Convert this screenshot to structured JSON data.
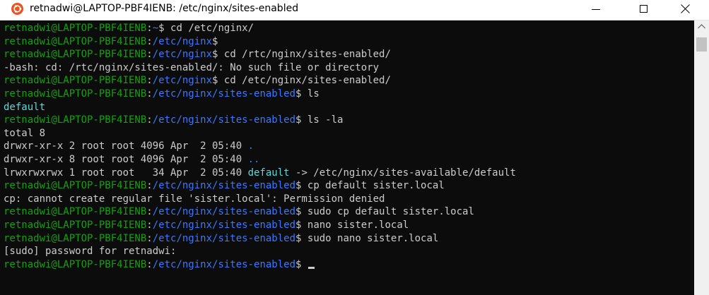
{
  "window": {
    "title": "retnadwi@LAPTOP-PBF4IENB: /etc/nginx/sites-enabled",
    "app_icon": "ubuntu-icon",
    "controls": [
      "minimize-icon",
      "maximize-icon",
      "close-icon"
    ]
  },
  "colors": {
    "terminal_bg": "#0c0c0c",
    "text": "#cccccc",
    "user_host": "#13a10e",
    "path": "#3b78ff",
    "symlink": "#61d6d6",
    "app_icon": "#e95420"
  },
  "terminal": {
    "lines": [
      {
        "type": "prompt",
        "user": "retnadwi@LAPTOP-PBF4IENB",
        "sep": ":",
        "path": "~",
        "sym": "$",
        "cmd": " cd /etc/nginx/"
      },
      {
        "type": "prompt",
        "user": "retnadwi@LAPTOP-PBF4IENB",
        "sep": ":",
        "path": "/etc/nginx",
        "sym": "$",
        "cmd": ""
      },
      {
        "type": "prompt",
        "user": "retnadwi@LAPTOP-PBF4IENB",
        "sep": ":",
        "path": "/etc/nginx",
        "sym": "$",
        "cmd": " cd /rtc/nginx/sites-enabled/"
      },
      {
        "type": "output",
        "text": "-bash: cd: /rtc/nginx/sites-enabled/: No such file or directory"
      },
      {
        "type": "prompt",
        "user": "retnadwi@LAPTOP-PBF4IENB",
        "sep": ":",
        "path": "/etc/nginx",
        "sym": "$",
        "cmd": " cd /etc/nginx/sites-enabled/"
      },
      {
        "type": "prompt",
        "user": "retnadwi@LAPTOP-PBF4IENB",
        "sep": ":",
        "path": "/etc/nginx/sites-enabled",
        "sym": "$",
        "cmd": " ls"
      },
      {
        "type": "ls",
        "name": "default"
      },
      {
        "type": "prompt",
        "user": "retnadwi@LAPTOP-PBF4IENB",
        "sep": ":",
        "path": "/etc/nginx/sites-enabled",
        "sym": "$",
        "cmd": " ls -la"
      },
      {
        "type": "output",
        "text": "total 8"
      },
      {
        "type": "entry",
        "pre": "drwxr-xr-x 2 root root 4096 Apr  2 05:40 ",
        "name": ".",
        "post": "",
        "kind": "dir"
      },
      {
        "type": "entry",
        "pre": "drwxr-xr-x 8 root root 4096 Apr  2 05:40 ",
        "name": "..",
        "post": "",
        "kind": "dir"
      },
      {
        "type": "entry",
        "pre": "lrwxrwxrwx 1 root root   34 Apr  2 05:40 ",
        "name": "default",
        "post": " -> /etc/nginx/sites-available/default",
        "kind": "link"
      },
      {
        "type": "prompt",
        "user": "retnadwi@LAPTOP-PBF4IENB",
        "sep": ":",
        "path": "/etc/nginx/sites-enabled",
        "sym": "$",
        "cmd": " cp default sister.local"
      },
      {
        "type": "output",
        "text": "cp: cannot create regular file 'sister.local': Permission denied"
      },
      {
        "type": "prompt",
        "user": "retnadwi@LAPTOP-PBF4IENB",
        "sep": ":",
        "path": "/etc/nginx/sites-enabled",
        "sym": "$",
        "cmd": " sudo cp default sister.local"
      },
      {
        "type": "prompt",
        "user": "retnadwi@LAPTOP-PBF4IENB",
        "sep": ":",
        "path": "/etc/nginx/sites-enabled",
        "sym": "$",
        "cmd": " nano sister.local"
      },
      {
        "type": "prompt",
        "user": "retnadwi@LAPTOP-PBF4IENB",
        "sep": ":",
        "path": "/etc/nginx/sites-enabled",
        "sym": "$",
        "cmd": " sudo nano sister.local"
      },
      {
        "type": "output",
        "text": "[sudo] password for retnadwi:"
      },
      {
        "type": "prompt",
        "user": "retnadwi@LAPTOP-PBF4IENB",
        "sep": ":",
        "path": "/etc/nginx/sites-enabled",
        "sym": "$",
        "cmd": " ",
        "cursor": true
      }
    ]
  }
}
